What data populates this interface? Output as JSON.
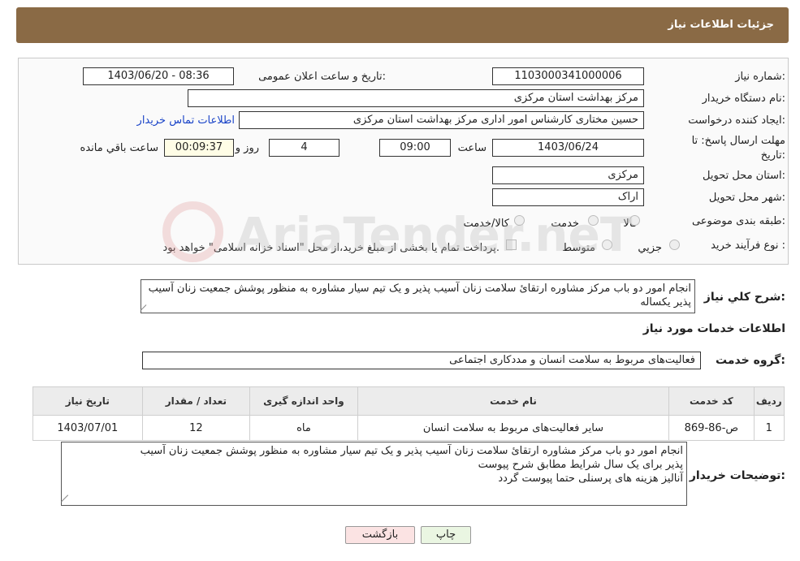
{
  "header": {
    "title": "جزئیات اطلاعات نیاز"
  },
  "form": {
    "need_number_label": "شماره نیاز:",
    "need_number": "1103000341000006",
    "announce_label": "تاریخ و ساعت اعلان عمومی:",
    "announce_value": "1403/06/20 - 08:36",
    "buyer_org_label": "نام دستگاه خریدار:",
    "buyer_org": "مرکز بهداشت استان مرکزی",
    "creator_label": "ایجاد کننده درخواست:",
    "creator": "حسین مختاری کارشناس امور اداری مرکز بهداشت استان مرکزی",
    "contact_link": "اطلاعات تماس خریدار",
    "deadline_label_1": "مهلت ارسال پاسخ: تا",
    "deadline_label_2": "تاریخ:",
    "deadline_date": "1403/06/24",
    "time_label": "ساعت",
    "deadline_time": "09:00",
    "days_value": "4",
    "days_label": "روز و",
    "remaining_time": "00:09:37",
    "remaining_label": "ساعت باقي مانده",
    "province_label": "استان محل تحویل:",
    "province": "مرکزی",
    "city_label": "شهر محل تحویل:",
    "city": "اراک",
    "category_label": "طبقه بندی موضوعی:",
    "category_options": [
      "کالا",
      "خدمت",
      "کالا/خدمت"
    ],
    "process_label": "نوع فرآیند خرید :",
    "process_options": [
      "جزیي",
      "متوسط"
    ],
    "payment_note": "پرداخت تمام یا بخشی از مبلغ خرید،از محل \"اسناد خزانه اسلامی\" خواهد بود."
  },
  "summary": {
    "label": "شرح کلي نیاز:",
    "text": "انجام امور دو باب مرکز مشاوره ارتقائ سلامت زنان آسیب پذیر و یک تیم سیار مشاوره به منظور پوشش جمعیت زنان آسیب پذیر یکساله"
  },
  "services": {
    "section_title": "اطلاعات خدمات مورد نیاز",
    "group_label": "گروه خدمت:",
    "group_value": "فعالیت‌های مربوط به سلامت انسان و مددکاری اجتماعی",
    "columns": [
      "ردیف",
      "کد خدمت",
      "نام خدمت",
      "واحد اندازه گیری",
      "تعداد / مقدار",
      "تاریخ نیاز"
    ],
    "rows": [
      [
        "1",
        "ص-86-869",
        "سایر فعالیت‌های مربوط به سلامت انسان",
        "ماه",
        "12",
        "1403/07/01"
      ]
    ]
  },
  "buyer_notes": {
    "label": "توضیحات خریدار:",
    "lines": [
      "انجام امور دو باب مرکز مشاوره ارتقائ سلامت زنان آسیب پذیر و یک تیم سیار مشاوره به منظور پوشش جمعیت زنان آسیب",
      "پذیر برای یک سال شرایط مطابق شرح پیوست",
      "آنالیز هزینه های پرسنلی حتما پیوست گردد"
    ]
  },
  "buttons": {
    "print": "چاپ",
    "back": "بازگشت"
  },
  "watermark": "AriaTender.neT",
  "colors": {
    "header": "#8a6a45",
    "link": "#1a44c8",
    "print_btn": "#eaf6e2",
    "back_btn": "#fbe3e3"
  }
}
